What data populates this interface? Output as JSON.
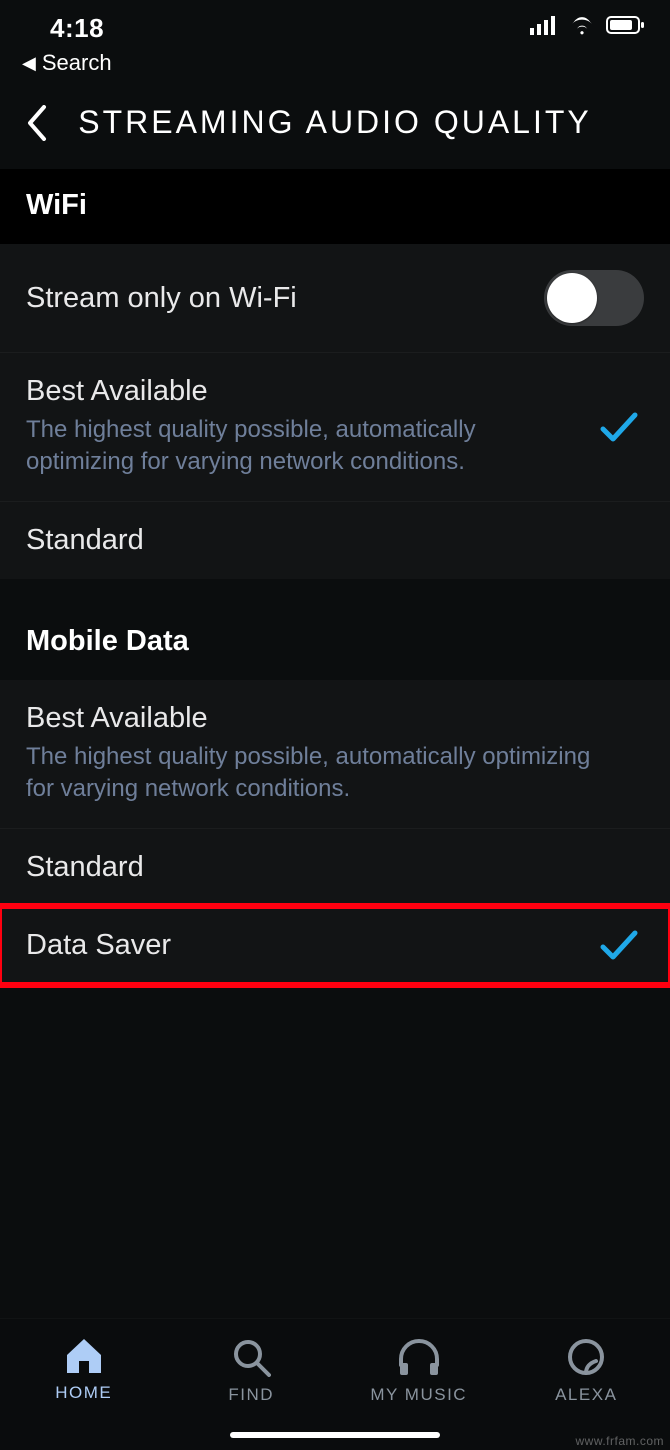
{
  "status": {
    "time": "4:18"
  },
  "nav": {
    "back_target": "Search"
  },
  "header": {
    "title": "STREAMING AUDIO QUALITY"
  },
  "sections": {
    "wifi": {
      "title": "WiFi",
      "stream_only": {
        "label": "Stream only on Wi-Fi",
        "on": false
      },
      "options": [
        {
          "label": "Best Available",
          "sub": "The highest quality possible, automatically optimizing for varying network conditions.",
          "selected": true
        },
        {
          "label": "Standard",
          "selected": false
        }
      ]
    },
    "mobile": {
      "title": "Mobile Data",
      "options": [
        {
          "label": "Best Available",
          "sub": "The highest quality possible, automatically optimizing for varying network conditions.",
          "selected": false
        },
        {
          "label": "Standard",
          "selected": false
        },
        {
          "label": "Data Saver",
          "selected": true
        }
      ]
    }
  },
  "tabs": [
    {
      "label": "HOME",
      "active": true
    },
    {
      "label": "FIND",
      "active": false
    },
    {
      "label": "MY MUSIC",
      "active": false
    },
    {
      "label": "ALEXA",
      "active": false
    }
  ],
  "watermark": "www.frfam.com",
  "colors": {
    "accent": "#1fa8e8",
    "muted_link": "#6f7f9a",
    "tab_active": "#aecdf6"
  }
}
